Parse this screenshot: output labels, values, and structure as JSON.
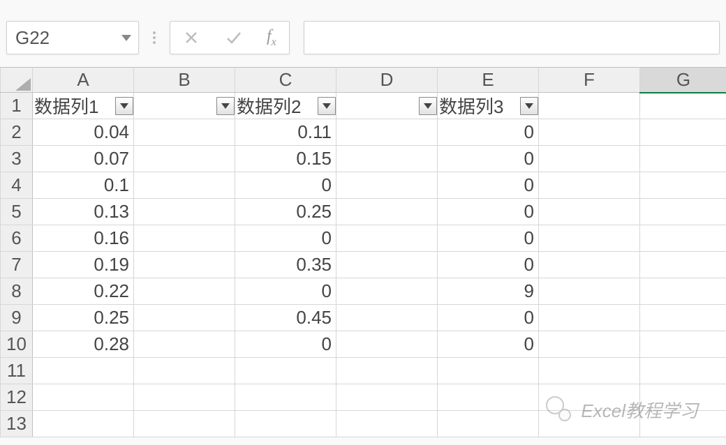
{
  "name_box": {
    "value": "G22"
  },
  "formula_bar": {
    "cancel_icon": "cancel-icon",
    "enter_icon": "enter-icon",
    "fx_label": "fx",
    "value": ""
  },
  "columns": [
    "A",
    "B",
    "C",
    "D",
    "E",
    "F",
    "G"
  ],
  "selected_column": "G",
  "row_headers": [
    "1",
    "2",
    "3",
    "4",
    "5",
    "6",
    "7",
    "8",
    "9",
    "10",
    "11",
    "12",
    "13"
  ],
  "headers": {
    "A": "数据列1",
    "B": "",
    "C": "数据列2",
    "D": "",
    "E": "数据列3",
    "F": "",
    "G": ""
  },
  "rows": [
    {
      "A": "0.04",
      "B": "",
      "C": "0.11",
      "D": "",
      "E": "0",
      "F": "",
      "G": ""
    },
    {
      "A": "0.07",
      "B": "",
      "C": "0.15",
      "D": "",
      "E": "0",
      "F": "",
      "G": ""
    },
    {
      "A": "0.1",
      "B": "",
      "C": "0",
      "D": "",
      "E": "0",
      "F": "",
      "G": ""
    },
    {
      "A": "0.13",
      "B": "",
      "C": "0.25",
      "D": "",
      "E": "0",
      "F": "",
      "G": ""
    },
    {
      "A": "0.16",
      "B": "",
      "C": "0",
      "D": "",
      "E": "0",
      "F": "",
      "G": ""
    },
    {
      "A": "0.19",
      "B": "",
      "C": "0.35",
      "D": "",
      "E": "0",
      "F": "",
      "G": ""
    },
    {
      "A": "0.22",
      "B": "",
      "C": "0",
      "D": "",
      "E": "9",
      "F": "",
      "G": ""
    },
    {
      "A": "0.25",
      "B": "",
      "C": "0.45",
      "D": "",
      "E": "0",
      "F": "",
      "G": ""
    },
    {
      "A": "0.28",
      "B": "",
      "C": "0",
      "D": "",
      "E": "0",
      "F": "",
      "G": ""
    },
    {
      "A": "",
      "B": "",
      "C": "",
      "D": "",
      "E": "",
      "F": "",
      "G": ""
    },
    {
      "A": "",
      "B": "",
      "C": "",
      "D": "",
      "E": "",
      "F": "",
      "G": ""
    },
    {
      "A": "",
      "B": "",
      "C": "",
      "D": "",
      "E": "",
      "F": "",
      "G": ""
    }
  ],
  "watermark": {
    "text": "Excel教程学习"
  }
}
